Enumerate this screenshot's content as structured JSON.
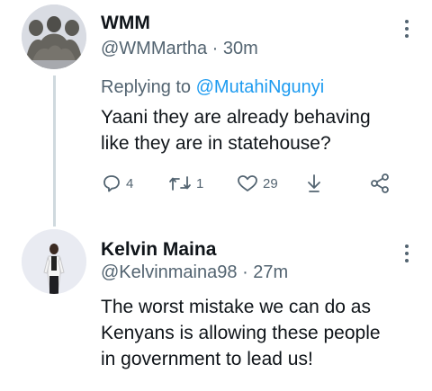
{
  "tweets": [
    {
      "author_name": "WMM",
      "handle": "@WMMartha",
      "separator": "·",
      "time": "30m",
      "replying_prefix": "Replying to",
      "replying_to": "@MutahiNgunyi",
      "text_line1": "Yaani they are already behaving",
      "text_line2": "like they are in statehouse?",
      "replies": "4",
      "retweets": "1",
      "likes": "29",
      "avatar_icon": "statue-avatar",
      "action_icons": [
        "reply-icon",
        "retweet-icon",
        "like-icon",
        "download-icon",
        "share-icon"
      ]
    },
    {
      "author_name": "Kelvin Maina",
      "handle": "@Kelvinmaina98",
      "separator": "·",
      "time": "27m",
      "text_line1": "The worst mistake we can do as",
      "text_line2": "Kenyans is allowing these people",
      "text_line3": "in government to lead us!",
      "avatar_icon": "person-avatar"
    }
  ],
  "colors": {
    "primary_text": "#0f1419",
    "secondary_text": "#536471",
    "mention": "#1d9bf0",
    "thread_line": "#cfd9de"
  }
}
